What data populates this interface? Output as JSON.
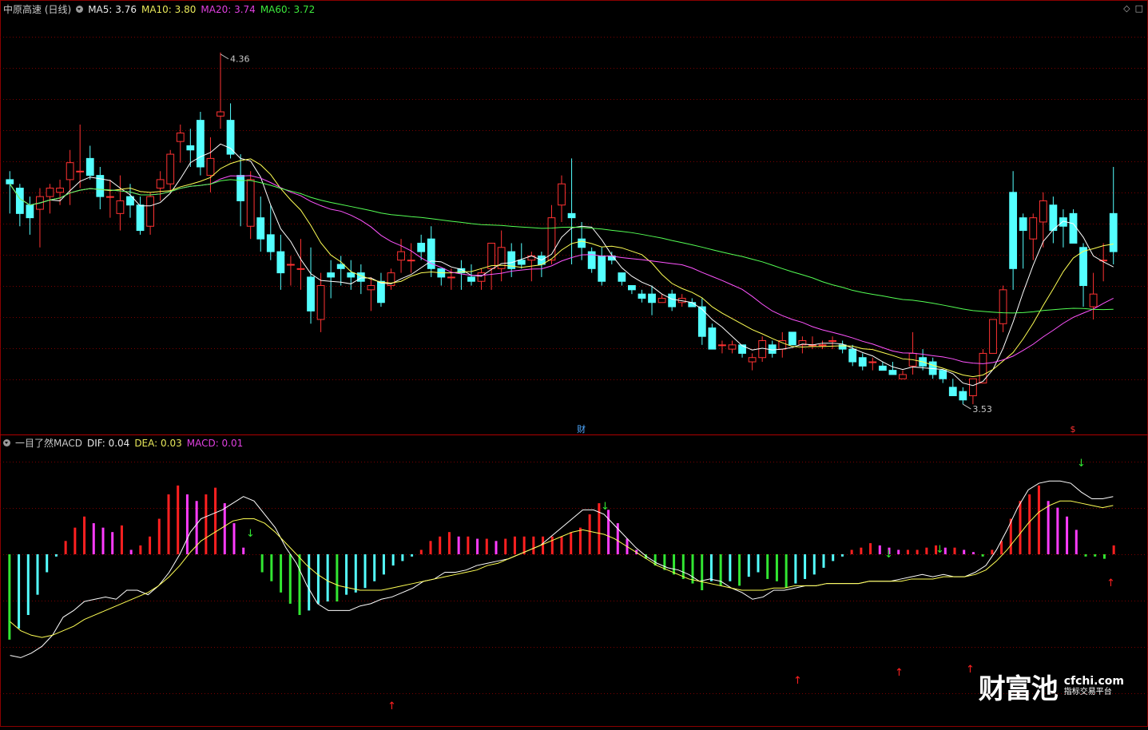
{
  "header": {
    "title": "中原高速 (日线)",
    "ma5": "MA5: 3.76",
    "ma10": "MA10: 3.80",
    "ma20": "MA20: 3.74",
    "ma60": "MA60: 3.72"
  },
  "indicator": {
    "title": "一目了然MACD",
    "dif": "DIF: 0.04",
    "dea": "DEA: 0.03",
    "macd": "MACD: 0.01"
  },
  "annotations": {
    "high_label": "4.36",
    "low_label": "3.53",
    "marker_cai": "财",
    "marker_s": "$"
  },
  "watermark": {
    "logo": "财富池",
    "domain": "cfchi.com",
    "tagline": "指标交易平台"
  },
  "colors": {
    "bg": "#000000",
    "up_candle": "#ff3232",
    "down_candle": "#54ffff",
    "ma5": "#ffffff",
    "ma10": "#ffff54",
    "ma20": "#ff54ff",
    "ma60": "#54ff54",
    "grid": "#7a0000"
  },
  "chart_data": [
    {
      "type": "candlestick",
      "name": "price",
      "ylim": [
        3.5,
        4.45
      ],
      "high": 4.36,
      "low": 3.53,
      "ohlc": [
        [
          4.06,
          4.08,
          3.98,
          4.05
        ],
        [
          4.04,
          4.05,
          3.95,
          3.98
        ],
        [
          4.0,
          4.02,
          3.93,
          3.97
        ],
        [
          3.99,
          4.04,
          3.9,
          4.02
        ],
        [
          4.02,
          4.05,
          3.98,
          4.04
        ],
        [
          4.03,
          4.06,
          4.0,
          4.04
        ],
        [
          4.06,
          4.13,
          4.0,
          4.1
        ],
        [
          4.08,
          4.19,
          4.04,
          4.08
        ],
        [
          4.11,
          4.14,
          4.06,
          4.07
        ],
        [
          4.07,
          4.09,
          3.99,
          4.02
        ],
        [
          4.02,
          4.06,
          3.97,
          4.02
        ],
        [
          3.98,
          4.07,
          3.94,
          4.01
        ],
        [
          4.02,
          4.05,
          3.97,
          4.0
        ],
        [
          4.0,
          4.02,
          3.93,
          3.94
        ],
        [
          3.95,
          4.03,
          3.93,
          4.02
        ],
        [
          4.04,
          4.08,
          4.01,
          4.06
        ],
        [
          4.05,
          4.13,
          4.03,
          4.12
        ],
        [
          4.15,
          4.19,
          4.1,
          4.17
        ],
        [
          4.14,
          4.18,
          4.09,
          4.13
        ],
        [
          4.2,
          4.22,
          4.07,
          4.09
        ],
        [
          4.07,
          4.16,
          4.03,
          4.11
        ],
        [
          4.21,
          4.36,
          4.18,
          4.22
        ],
        [
          4.2,
          4.24,
          4.11,
          4.12
        ],
        [
          4.07,
          4.12,
          3.95,
          4.01
        ],
        [
          3.95,
          4.08,
          3.92,
          4.06
        ],
        [
          3.97,
          4.02,
          3.89,
          3.92
        ],
        [
          3.93,
          4.0,
          3.87,
          3.89
        ],
        [
          3.89,
          3.93,
          3.8,
          3.84
        ],
        [
          3.86,
          3.88,
          3.81,
          3.86
        ],
        [
          3.85,
          3.92,
          3.8,
          3.85
        ],
        [
          3.83,
          3.9,
          3.72,
          3.75
        ],
        [
          3.73,
          3.84,
          3.7,
          3.81
        ],
        [
          3.84,
          3.87,
          3.78,
          3.83
        ],
        [
          3.86,
          3.88,
          3.81,
          3.85
        ],
        [
          3.84,
          3.87,
          3.8,
          3.83
        ],
        [
          3.84,
          3.86,
          3.79,
          3.82
        ],
        [
          3.8,
          3.83,
          3.75,
          3.81
        ],
        [
          3.82,
          3.84,
          3.76,
          3.77
        ],
        [
          3.81,
          3.85,
          3.8,
          3.84
        ],
        [
          3.87,
          3.92,
          3.84,
          3.89
        ],
        [
          3.87,
          3.91,
          3.84,
          3.87
        ],
        [
          3.91,
          3.93,
          3.87,
          3.89
        ],
        [
          3.92,
          3.95,
          3.83,
          3.85
        ],
        [
          3.85,
          3.85,
          3.81,
          3.83
        ],
        [
          3.83,
          3.85,
          3.8,
          3.83
        ],
        [
          3.85,
          3.87,
          3.8,
          3.84
        ],
        [
          3.83,
          3.86,
          3.81,
          3.82
        ],
        [
          3.82,
          3.85,
          3.8,
          3.84
        ],
        [
          3.85,
          3.91,
          3.8,
          3.91
        ],
        [
          3.85,
          3.94,
          3.82,
          3.9
        ],
        [
          3.89,
          3.91,
          3.83,
          3.85
        ],
        [
          3.87,
          3.91,
          3.85,
          3.86
        ],
        [
          3.87,
          3.89,
          3.82,
          3.88
        ],
        [
          3.88,
          3.89,
          3.83,
          3.86
        ],
        [
          3.87,
          4.0,
          3.86,
          3.97
        ],
        [
          4.0,
          4.07,
          3.96,
          4.05
        ],
        [
          3.98,
          4.11,
          3.86,
          3.97
        ],
        [
          3.92,
          3.96,
          3.87,
          3.9
        ],
        [
          3.89,
          3.9,
          3.84,
          3.85
        ],
        [
          3.88,
          3.9,
          3.81,
          3.82
        ],
        [
          3.88,
          3.89,
          3.86,
          3.87
        ],
        [
          3.84,
          3.84,
          3.81,
          3.82
        ],
        [
          3.81,
          3.81,
          3.79,
          3.8
        ],
        [
          3.79,
          3.8,
          3.77,
          3.78
        ],
        [
          3.79,
          3.81,
          3.74,
          3.77
        ],
        [
          3.77,
          3.79,
          3.77,
          3.78
        ],
        [
          3.79,
          3.8,
          3.75,
          3.76
        ],
        [
          3.77,
          3.79,
          3.76,
          3.78
        ],
        [
          3.77,
          3.78,
          3.76,
          3.76
        ],
        [
          3.76,
          3.78,
          3.67,
          3.69
        ],
        [
          3.71,
          3.72,
          3.66,
          3.66
        ],
        [
          3.67,
          3.68,
          3.65,
          3.67
        ],
        [
          3.66,
          3.68,
          3.65,
          3.67
        ],
        [
          3.67,
          3.67,
          3.64,
          3.65
        ],
        [
          3.63,
          3.65,
          3.61,
          3.64
        ],
        [
          3.64,
          3.69,
          3.63,
          3.68
        ],
        [
          3.67,
          3.68,
          3.64,
          3.65
        ],
        [
          3.66,
          3.7,
          3.64,
          3.68
        ],
        [
          3.7,
          3.7,
          3.67,
          3.67
        ],
        [
          3.67,
          3.69,
          3.65,
          3.68
        ],
        [
          3.67,
          3.69,
          3.66,
          3.67
        ],
        [
          3.67,
          3.68,
          3.66,
          3.67
        ],
        [
          3.68,
          3.69,
          3.66,
          3.68
        ],
        [
          3.67,
          3.68,
          3.65,
          3.66
        ],
        [
          3.66,
          3.67,
          3.62,
          3.63
        ],
        [
          3.64,
          3.65,
          3.61,
          3.62
        ],
        [
          3.63,
          3.64,
          3.61,
          3.63
        ],
        [
          3.62,
          3.63,
          3.61,
          3.61
        ],
        [
          3.61,
          3.63,
          3.6,
          3.6
        ],
        [
          3.59,
          3.61,
          3.59,
          3.6
        ],
        [
          3.62,
          3.7,
          3.6,
          3.65
        ],
        [
          3.64,
          3.66,
          3.61,
          3.62
        ],
        [
          3.63,
          3.64,
          3.59,
          3.6
        ],
        [
          3.61,
          3.61,
          3.58,
          3.59
        ],
        [
          3.57,
          3.59,
          3.55,
          3.55
        ],
        [
          3.56,
          3.57,
          3.53,
          3.54
        ],
        [
          3.55,
          3.59,
          3.53,
          3.59
        ],
        [
          3.58,
          3.66,
          3.58,
          3.65
        ],
        [
          3.65,
          3.73,
          3.65,
          3.73
        ],
        [
          3.72,
          3.81,
          3.7,
          3.8
        ],
        [
          4.03,
          4.08,
          3.8,
          3.85
        ],
        [
          3.97,
          3.98,
          3.85,
          3.94
        ],
        [
          3.92,
          3.98,
          3.87,
          3.97
        ],
        [
          3.96,
          4.03,
          3.9,
          4.01
        ],
        [
          4.0,
          4.02,
          3.91,
          3.94
        ],
        [
          3.97,
          3.99,
          3.9,
          3.95
        ],
        [
          3.98,
          3.99,
          3.91,
          3.91
        ],
        [
          3.9,
          3.91,
          3.76,
          3.81
        ],
        [
          3.76,
          3.84,
          3.73,
          3.79
        ],
        [
          3.87,
          3.91,
          3.82,
          3.87
        ],
        [
          3.98,
          4.09,
          3.86,
          3.89
        ]
      ]
    },
    {
      "type": "bar",
      "name": "macd",
      "ylim": [
        -0.075,
        0.05
      ],
      "values": [
        -0.038,
        -0.033,
        -0.027,
        -0.018,
        -0.008,
        -0.001,
        0.006,
        0.012,
        0.017,
        0.014,
        0.012,
        0.01,
        0.013,
        0.002,
        0.004,
        0.008,
        0.016,
        0.027,
        0.031,
        0.027,
        0.024,
        0.027,
        0.03,
        0.023,
        0.014,
        0.003,
        0.0,
        -0.008,
        -0.012,
        -0.017,
        -0.022,
        -0.027,
        -0.025,
        -0.022,
        -0.021,
        -0.021,
        -0.018,
        -0.017,
        -0.015,
        -0.012,
        -0.009,
        -0.005,
        -0.003,
        -0.001,
        0.002,
        0.006,
        0.008,
        0.01,
        0.008,
        0.008,
        0.007,
        0.007,
        0.006,
        0.007,
        0.008,
        0.008,
        0.008,
        0.008,
        0.008,
        0.008,
        0.01,
        0.012,
        0.018,
        0.023,
        0.02,
        0.014,
        0.007,
        0.002,
        -0.002,
        -0.005,
        -0.007,
        -0.009,
        -0.011,
        -0.013,
        -0.016,
        -0.012,
        -0.014,
        -0.012,
        -0.014,
        -0.01,
        -0.008,
        -0.011,
        -0.012,
        -0.015,
        -0.013,
        -0.011,
        -0.009,
        -0.006,
        -0.003,
        -0.001,
        0.002,
        0.003,
        0.005,
        0.004,
        0.003,
        0.002,
        0.002,
        0.002,
        0.003,
        0.004,
        0.003,
        0.003,
        0.002,
        0.001,
        -0.001,
        0.002,
        0.006,
        0.016,
        0.024,
        0.027,
        0.031,
        0.024,
        0.021,
        0.017,
        0.011,
        -0.001,
        -0.001,
        -0.002,
        0.004
      ],
      "dif": [
        -0.045,
        -0.046,
        -0.044,
        -0.041,
        -0.036,
        -0.028,
        -0.025,
        -0.021,
        -0.02,
        -0.019,
        -0.02,
        -0.016,
        -0.016,
        -0.018,
        -0.014,
        -0.008,
        0.0,
        0.01,
        0.016,
        0.018,
        0.02,
        0.023,
        0.026,
        0.024,
        0.018,
        0.012,
        0.003,
        -0.004,
        -0.014,
        -0.022,
        -0.025,
        -0.025,
        -0.025,
        -0.023,
        -0.022,
        -0.02,
        -0.019,
        -0.017,
        -0.015,
        -0.012,
        -0.011,
        -0.008,
        -0.008,
        -0.007,
        -0.005,
        -0.004,
        -0.003,
        -0.002,
        0.0,
        0.002,
        0.004,
        0.008,
        0.012,
        0.016,
        0.02,
        0.02,
        0.018,
        0.013,
        0.008,
        0.003,
        -0.001,
        -0.004,
        -0.006,
        -0.007,
        -0.009,
        -0.012,
        -0.011,
        -0.012,
        -0.015,
        -0.017,
        -0.02,
        -0.019,
        -0.016,
        -0.016,
        -0.015,
        -0.014,
        -0.014,
        -0.013,
        -0.013,
        -0.013,
        -0.013,
        -0.012,
        -0.012,
        -0.012,
        -0.011,
        -0.01,
        -0.009,
        -0.01,
        -0.009,
        -0.01,
        -0.01,
        -0.008,
        -0.005,
        0.002,
        0.011,
        0.021,
        0.029,
        0.032,
        0.033,
        0.033,
        0.032,
        0.028,
        0.025,
        0.025,
        0.026
      ],
      "dea": [
        -0.03,
        -0.034,
        -0.036,
        -0.037,
        -0.036,
        -0.034,
        -0.032,
        -0.029,
        -0.027,
        -0.025,
        -0.023,
        -0.021,
        -0.019,
        -0.017,
        -0.014,
        -0.01,
        -0.005,
        0.001,
        0.006,
        0.009,
        0.012,
        0.015,
        0.016,
        0.016,
        0.014,
        0.01,
        0.005,
        0.0,
        -0.005,
        -0.009,
        -0.012,
        -0.014,
        -0.015,
        -0.016,
        -0.016,
        -0.016,
        -0.015,
        -0.014,
        -0.013,
        -0.012,
        -0.011,
        -0.01,
        -0.009,
        -0.008,
        -0.007,
        -0.005,
        -0.004,
        -0.002,
        0.0,
        0.002,
        0.004,
        0.006,
        0.008,
        0.01,
        0.011,
        0.01,
        0.009,
        0.007,
        0.004,
        0.001,
        -0.002,
        -0.005,
        -0.007,
        -0.009,
        -0.011,
        -0.012,
        -0.013,
        -0.014,
        -0.015,
        -0.016,
        -0.016,
        -0.016,
        -0.015,
        -0.015,
        -0.014,
        -0.014,
        -0.014,
        -0.013,
        -0.013,
        -0.013,
        -0.013,
        -0.012,
        -0.012,
        -0.012,
        -0.012,
        -0.011,
        -0.011,
        -0.011,
        -0.01,
        -0.01,
        -0.01,
        -0.009,
        -0.007,
        -0.003,
        0.002,
        0.008,
        0.014,
        0.019,
        0.022,
        0.024,
        0.024,
        0.023,
        0.022,
        0.021,
        0.022
      ]
    }
  ]
}
